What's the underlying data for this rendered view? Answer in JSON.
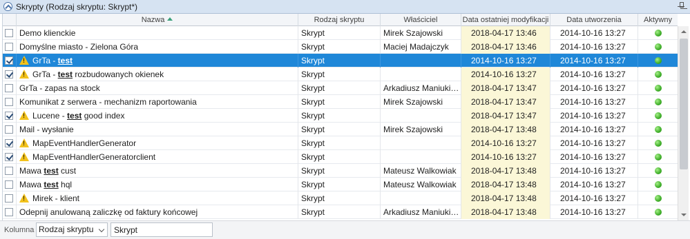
{
  "panel": {
    "title": "Skrypty (Rodzaj skryptu: Skrypt*)"
  },
  "columns": {
    "name": "Nazwa",
    "type": "Rodzaj skryptu",
    "owner": "Właściciel",
    "modified": "Data ostatniej modyfikacji",
    "created": "Data utworzenia",
    "active": "Aktywny"
  },
  "rows": [
    {
      "checked": false,
      "warn": false,
      "name": "Demo klienckie",
      "type": "Skrypt",
      "owner": "Mirek Szajowski",
      "modified": "2018-04-17 13:46",
      "created": "2014-10-16 13:27",
      "active": true,
      "selected": false
    },
    {
      "checked": false,
      "warn": false,
      "name": "Domyślne miasto - Zielona Góra",
      "type": "Skrypt",
      "owner": "Maciej Madajczyk",
      "modified": "2018-04-17 13:46",
      "created": "2014-10-16 13:27",
      "active": true,
      "selected": false
    },
    {
      "checked": true,
      "warn": true,
      "name_pre": "GrTa - ",
      "name_bold": "test",
      "name_post": "",
      "type": "Skrypt",
      "owner": "",
      "modified": "2014-10-16 13:27",
      "created": "2014-10-16 13:27",
      "active": true,
      "selected": true
    },
    {
      "checked": true,
      "warn": true,
      "name_pre": "GrTa - ",
      "name_bold": "test",
      "name_post": " rozbudowanych okienek",
      "type": "Skrypt",
      "owner": "",
      "modified": "2014-10-16 13:27",
      "created": "2014-10-16 13:27",
      "active": true,
      "selected": false
    },
    {
      "checked": false,
      "warn": false,
      "name": "GrTa - zapas na stock",
      "type": "Skrypt",
      "owner": "Arkadiusz Maniukie...",
      "modified": "2018-04-17 13:47",
      "created": "2014-10-16 13:27",
      "active": true,
      "selected": false
    },
    {
      "checked": false,
      "warn": false,
      "name": "Komunikat z serwera - mechanizm raportowania",
      "type": "Skrypt",
      "owner": "Mirek Szajowski",
      "modified": "2018-04-17 13:47",
      "created": "2014-10-16 13:27",
      "active": true,
      "selected": false
    },
    {
      "checked": true,
      "warn": true,
      "name_pre": "Lucene - ",
      "name_bold": "test",
      "name_post": " good index",
      "type": "Skrypt",
      "owner": "",
      "modified": "2018-04-17 13:47",
      "created": "2014-10-16 13:27",
      "active": true,
      "selected": false
    },
    {
      "checked": false,
      "warn": false,
      "name": "Mail - wysłanie",
      "type": "Skrypt",
      "owner": "Mirek Szajowski",
      "modified": "2018-04-17 13:48",
      "created": "2014-10-16 13:27",
      "active": true,
      "selected": false
    },
    {
      "checked": true,
      "warn": true,
      "name": "MapEventHandlerGenerator",
      "type": "Skrypt",
      "owner": "",
      "modified": "2014-10-16 13:27",
      "created": "2014-10-16 13:27",
      "active": true,
      "selected": false
    },
    {
      "checked": true,
      "warn": true,
      "name": "MapEventHandlerGeneratorclient",
      "type": "Skrypt",
      "owner": "",
      "modified": "2014-10-16 13:27",
      "created": "2014-10-16 13:27",
      "active": true,
      "selected": false
    },
    {
      "checked": false,
      "warn": false,
      "name_pre": "Mawa ",
      "name_bold": "test",
      "name_post": " cust",
      "type": "Skrypt",
      "owner": "Mateusz Walkowiak",
      "modified": "2018-04-17 13:48",
      "created": "2014-10-16 13:27",
      "active": true,
      "selected": false
    },
    {
      "checked": false,
      "warn": false,
      "name_pre": "Mawa ",
      "name_bold": "test",
      "name_post": " hql",
      "type": "Skrypt",
      "owner": "Mateusz Walkowiak",
      "modified": "2018-04-17 13:48",
      "created": "2014-10-16 13:27",
      "active": true,
      "selected": false
    },
    {
      "checked": false,
      "warn": true,
      "name": "Mirek - klient",
      "type": "Skrypt",
      "owner": "",
      "modified": "2018-04-17 13:48",
      "created": "2014-10-16 13:27",
      "active": true,
      "selected": false
    },
    {
      "checked": false,
      "warn": false,
      "name": "Odepnij anulowaną zaliczkę od faktury końcowej",
      "type": "Skrypt",
      "owner": "Arkadiusz Maniukie...",
      "modified": "2018-04-17 13:48",
      "created": "2014-10-16 13:27",
      "active": true,
      "selected": false
    }
  ],
  "footer": {
    "column_label": "Kolumna",
    "column_value": "Rodzaj skryptu",
    "filter_value": "Skrypt"
  },
  "colors": {
    "selection": "#1f87d8",
    "highlight": "#fbf7d7",
    "active_dot": "#3fae29",
    "warning": "#f2c21c"
  }
}
